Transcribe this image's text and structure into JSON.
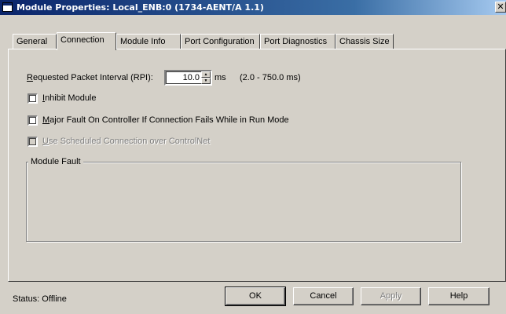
{
  "window": {
    "title": "Module Properties: Local_ENB:0 (1734-AENT/A 1.1)",
    "close_label": "✕"
  },
  "tabs": [
    {
      "label": "General"
    },
    {
      "label": "Connection",
      "active": true
    },
    {
      "label": "Module Info"
    },
    {
      "label": "Port Configuration"
    },
    {
      "label": "Port Diagnostics"
    },
    {
      "label": "Chassis Size"
    }
  ],
  "connection": {
    "rpi_label_prefix": "R",
    "rpi_label_rest": "equested Packet Interval (RPI):",
    "rpi_value": "10.0",
    "rpi_unit": "ms",
    "rpi_range": "(2.0 - 750.0 ms)",
    "inhibit_mnemonic": "I",
    "inhibit_rest": "nhibit Module",
    "inhibit_checked": false,
    "major_fault_mnemonic": "M",
    "major_fault_rest": "ajor Fault On Controller If Connection Fails While in Run Mode",
    "major_fault_checked": false,
    "scheduled_mnemonic": "U",
    "scheduled_rest": "se Scheduled Connection over ControlNet",
    "scheduled_checked": false,
    "scheduled_enabled": false,
    "module_fault_label": "Module Fault"
  },
  "status": {
    "text": "Status:  Offline"
  },
  "buttons": {
    "ok": "OK",
    "cancel": "Cancel",
    "apply": "Apply",
    "help": "Help"
  }
}
